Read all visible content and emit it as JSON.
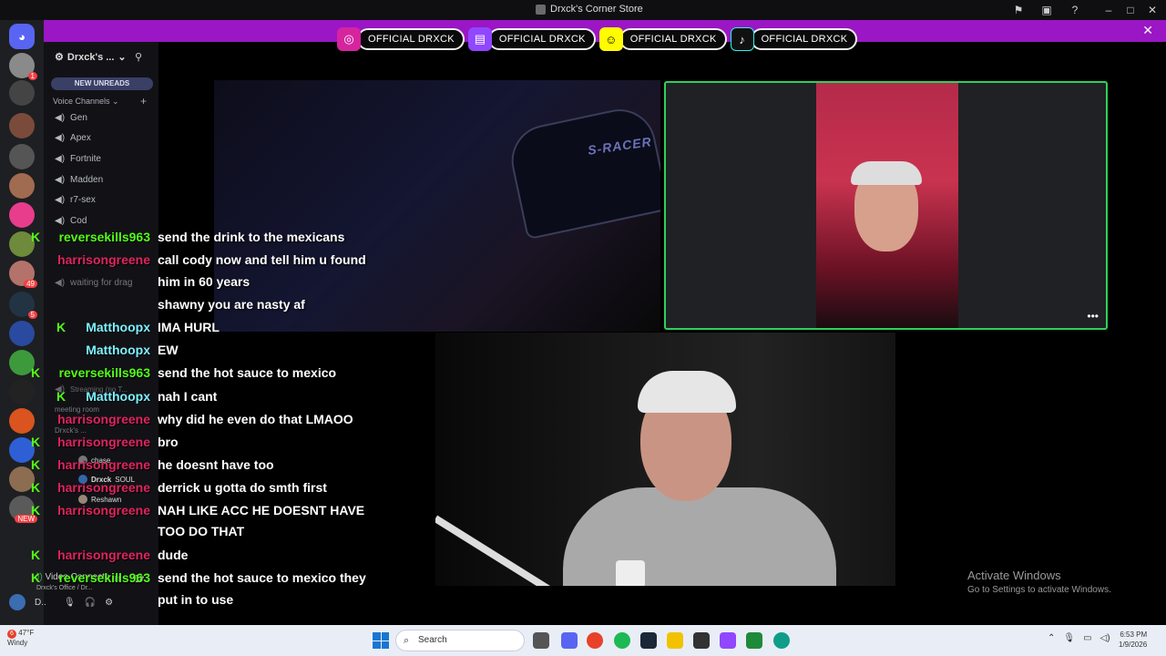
{
  "window": {
    "title": "Drxck's Corner Store"
  },
  "banner": {
    "close_icon": "close-icon",
    "socials": [
      {
        "label": "OFFICIAL DRXCK",
        "icon": "instagram-icon",
        "color": "#d6249f"
      },
      {
        "label": "OFFICIAL DRXCK",
        "icon": "twitch-icon",
        "color": "#9146ff"
      },
      {
        "label": "OFFICIAL DRXCK",
        "icon": "snapchat-icon",
        "color": "#fffc00"
      },
      {
        "label": "OFFICIAL DRXCK",
        "icon": "tiktok-icon",
        "color": "#111111"
      }
    ]
  },
  "discord": {
    "server_name": "Drxck's ...",
    "new_unreads": "NEW UNREADS",
    "voice_channels_label": "Voice Channels",
    "channels": [
      "Gen",
      "Apex",
      "Fortnite",
      "Madden",
      "r7-sex",
      "Cod"
    ],
    "obscured_channels": [
      "waiting for drag",
      "Streaming (no T...",
      "meeting room",
      "Drxck's ..."
    ],
    "voice_users": [
      {
        "name": "chase"
      },
      {
        "name": "Drxck",
        "tag": "SOUL"
      },
      {
        "name": "Reshawn"
      }
    ],
    "video_connected": "Video Connecte",
    "voice_location": "Drxck's Office / Dr...",
    "user_short": "D..",
    "rail_badges": [
      "1",
      "49",
      "5",
      "NEW"
    ]
  },
  "chat": {
    "messages": [
      {
        "user": "reversekills963",
        "color": "#53fc18",
        "badge": true,
        "text": "send the drink to the mexicans"
      },
      {
        "user": "harrisongreene",
        "color": "#e0245e",
        "badge": false,
        "text": "call cody now and tell him u found"
      },
      {
        "user": "",
        "color": "#ffffff",
        "badge": false,
        "text": "him in 60 years"
      },
      {
        "user": "",
        "color": "#ffffff",
        "badge": false,
        "text": "shawny you are nasty af"
      },
      {
        "user": "Matthoopx",
        "color": "#7ef0ff",
        "badge": true,
        "text": "IMA HURL"
      },
      {
        "user": "Matthoopx",
        "color": "#7ef0ff",
        "badge": false,
        "text": "EW"
      },
      {
        "user": "reversekills963",
        "color": "#53fc18",
        "badge": true,
        "text": "send the hot sauce to mexico"
      },
      {
        "user": "Matthoopx",
        "color": "#7ef0ff",
        "badge": true,
        "text": "nah I cant"
      },
      {
        "user": "harrisongreene",
        "color": "#e0245e",
        "badge": false,
        "text": "why did he even do that LMAOO"
      },
      {
        "user": "harrisongreene",
        "color": "#e0245e",
        "badge": true,
        "text": "bro"
      },
      {
        "user": "harrisongreene",
        "color": "#e0245e",
        "badge": true,
        "text": "he doesnt have too"
      },
      {
        "user": "harrisongreene",
        "color": "#e0245e",
        "badge": true,
        "text": "derrick u gotta do smth first"
      },
      {
        "user": "harrisongreene",
        "color": "#e0245e",
        "badge": true,
        "text": "NAH LIKE ACC HE DOESNT HAVE"
      },
      {
        "user": "",
        "color": "#ffffff",
        "badge": false,
        "text": "TOO DO THAT"
      },
      {
        "user": "harrisongreene",
        "color": "#e0245e",
        "badge": true,
        "text": "dude"
      },
      {
        "user": "reversekills963",
        "color": "#53fc18",
        "badge": true,
        "text": "send the hot sauce to mexico they"
      },
      {
        "user": "",
        "color": "#ffffff",
        "badge": false,
        "text": "put in to use"
      }
    ]
  },
  "video": {
    "chair_brand": "S-RACER"
  },
  "watermark": {
    "line1": "Activate Windows",
    "line2": "Go to Settings to activate Windows."
  },
  "taskbar": {
    "weather_temp": "47°F",
    "weather_desc": "Windy",
    "weather_badge": "6",
    "search_placeholder": "Search",
    "time": "6:53 PM",
    "date": "1/9/2026"
  }
}
